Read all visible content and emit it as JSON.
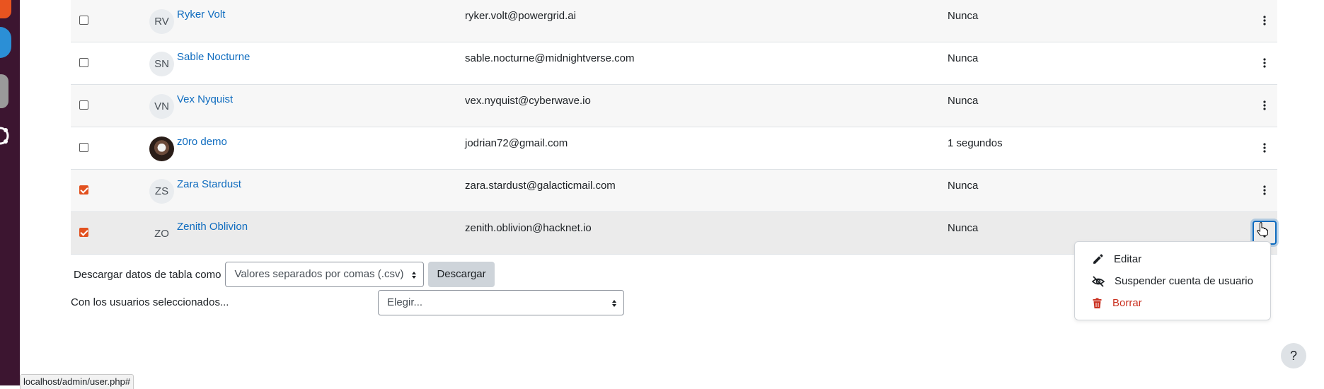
{
  "users": [
    {
      "initials": "RV",
      "name": "Ryker Volt",
      "email": "ryker.volt@powergrid.ai",
      "last_access": "Nunca",
      "checked": false,
      "photo": false
    },
    {
      "initials": "SN",
      "name": "Sable Nocturne",
      "email": "sable.nocturne@midnightverse.com",
      "last_access": "Nunca",
      "checked": false,
      "photo": false
    },
    {
      "initials": "VN",
      "name": "Vex Nyquist",
      "email": "vex.nyquist@cyberwave.io",
      "last_access": "Nunca",
      "checked": false,
      "photo": false
    },
    {
      "initials": "",
      "name": "z0ro demo",
      "email": "jodrian72@gmail.com",
      "last_access": "1 segundos",
      "checked": false,
      "photo": true
    },
    {
      "initials": "ZS",
      "name": "Zara Stardust",
      "email": "zara.stardust@galacticmail.com",
      "last_access": "Nunca",
      "checked": true,
      "photo": false
    },
    {
      "initials": "ZO",
      "name": "Zenith Oblivion",
      "email": "zenith.oblivion@hacknet.io",
      "last_access": "Nunca",
      "checked": true,
      "photo": false
    }
  ],
  "download": {
    "label": "Descargar datos de tabla como",
    "format": "Valores separados por comas (.csv)",
    "button": "Descargar"
  },
  "bulk": {
    "label": "Con los usuarios seleccionados...",
    "selected": "Elegir..."
  },
  "action_menu": {
    "items": [
      {
        "label": "Editar",
        "icon": "pencil-icon"
      },
      {
        "label": "Suspender cuenta de usuario",
        "icon": "eye-slash-icon"
      },
      {
        "label": "Borrar",
        "icon": "trash-icon"
      }
    ]
  },
  "help": {
    "label": "?"
  },
  "status_bar": {
    "url": "localhost/admin/user.php#"
  },
  "colors": {
    "link": "#0f6cbf",
    "checkbox": "#e2511f",
    "danger": "#ca3120",
    "dock": "#3c1530"
  }
}
